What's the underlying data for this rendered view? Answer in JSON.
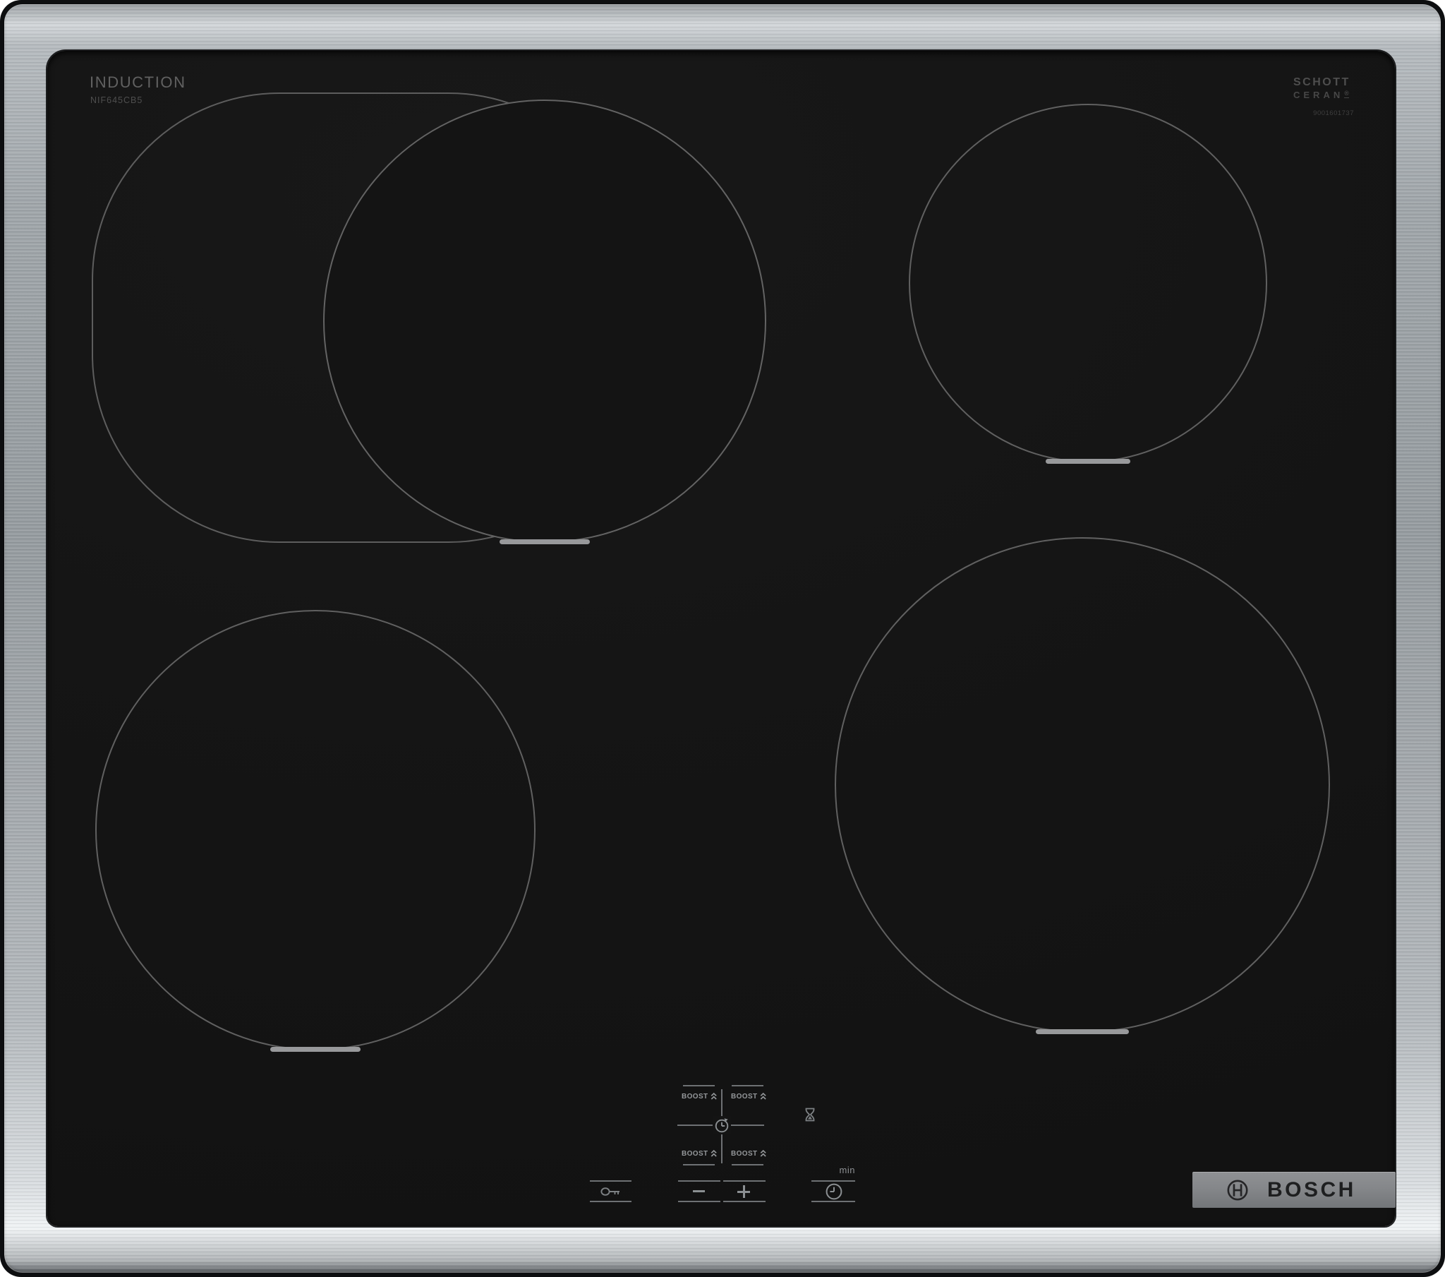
{
  "product": {
    "type_label": "INDUCTION",
    "model": "NIF645CB5"
  },
  "glass_brand": {
    "line1": "SCHOTT",
    "line2": "CERAN",
    "registered": "®",
    "serial": "9001601737"
  },
  "controls": {
    "boost_label": "BOOST",
    "minus_label": "",
    "plus_label": "",
    "min_label": "min"
  },
  "badge": {
    "brand": "BOSCH"
  },
  "colors": {
    "steel": "#a4a9ad",
    "glass": "#141414",
    "zone_line": "#5e5e5e",
    "zone_marker": "#98999b",
    "control_line": "#6e7174",
    "control_text": "#94979a",
    "badge_plate": "#85878a"
  }
}
